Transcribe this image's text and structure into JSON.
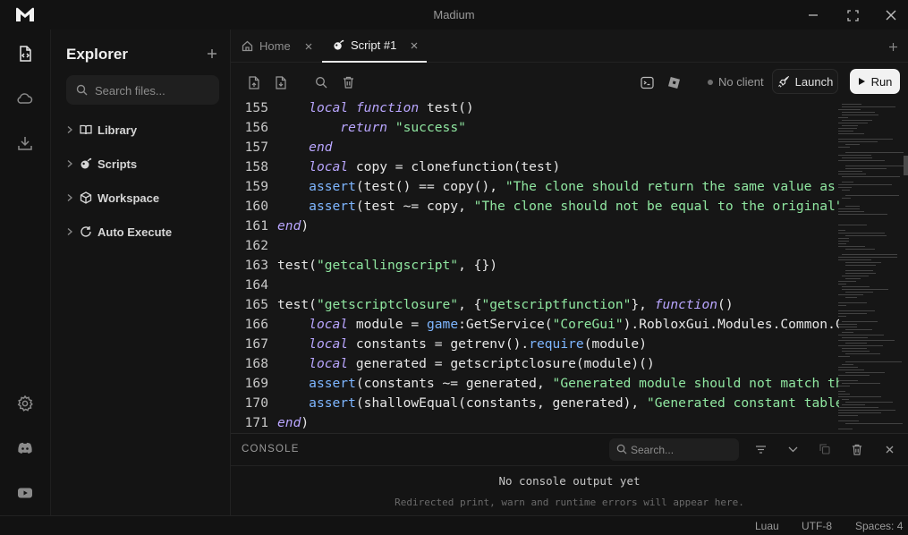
{
  "app": {
    "title": "Madium"
  },
  "explorer": {
    "title": "Explorer",
    "search_placeholder": "Search files...",
    "items": [
      {
        "label": "Library",
        "icon": "book-icon"
      },
      {
        "label": "Scripts",
        "icon": "script-icon"
      },
      {
        "label": "Workspace",
        "icon": "cube-icon"
      },
      {
        "label": "Auto Execute",
        "icon": "refresh-icon"
      }
    ]
  },
  "tabs": [
    {
      "label": "Home",
      "icon": "home-icon",
      "active": false
    },
    {
      "label": "Script #1",
      "icon": "script-icon",
      "active": true
    }
  ],
  "toolbar": {
    "client_status": "No client",
    "launch_label": "Launch",
    "run_label": "Run"
  },
  "editor": {
    "lines": [
      {
        "n": "155",
        "tokens": [
          [
            "",
            "    "
          ],
          [
            "kw",
            "local"
          ],
          [
            "",
            " "
          ],
          [
            "kw",
            "function"
          ],
          [
            "",
            " test()"
          ]
        ]
      },
      {
        "n": "156",
        "tokens": [
          [
            "",
            "        "
          ],
          [
            "kw",
            "return"
          ],
          [
            "",
            " "
          ],
          [
            "str",
            "\"success\""
          ]
        ]
      },
      {
        "n": "157",
        "tokens": [
          [
            "",
            "    "
          ],
          [
            "kw",
            "end"
          ]
        ]
      },
      {
        "n": "158",
        "tokens": [
          [
            "",
            "    "
          ],
          [
            "kw",
            "local"
          ],
          [
            "",
            " copy = clonefunction(test)"
          ]
        ]
      },
      {
        "n": "159",
        "tokens": [
          [
            "",
            "    "
          ],
          [
            "fnc",
            "assert"
          ],
          [
            "",
            "(test() == copy(), "
          ],
          [
            "str",
            "\"The clone should return the same value as the original\""
          ],
          [
            "",
            ")"
          ]
        ]
      },
      {
        "n": "160",
        "tokens": [
          [
            "",
            "    "
          ],
          [
            "fnc",
            "assert"
          ],
          [
            "",
            "(test ~= copy, "
          ],
          [
            "str",
            "\"The clone should not be equal to the original\""
          ],
          [
            "",
            ")"
          ]
        ]
      },
      {
        "n": "161",
        "tokens": [
          [
            "kw",
            "end"
          ],
          [
            "",
            ")"
          ]
        ]
      },
      {
        "n": "162",
        "tokens": []
      },
      {
        "n": "163",
        "tokens": [
          [
            "",
            "test("
          ],
          [
            "str",
            "\"getcallingscript\""
          ],
          [
            "",
            ", {})"
          ]
        ]
      },
      {
        "n": "164",
        "tokens": []
      },
      {
        "n": "165",
        "tokens": [
          [
            "",
            "test("
          ],
          [
            "str",
            "\"getscriptclosure\""
          ],
          [
            "",
            ", {"
          ],
          [
            "str",
            "\"getscriptfunction\""
          ],
          [
            "",
            "}, "
          ],
          [
            "kw",
            "function"
          ],
          [
            "",
            "()"
          ]
        ]
      },
      {
        "n": "166",
        "tokens": [
          [
            "",
            "    "
          ],
          [
            "kw",
            "local"
          ],
          [
            "",
            " module = "
          ],
          [
            "fnc",
            "game"
          ],
          [
            "",
            ":GetService("
          ],
          [
            "str",
            "\"CoreGui\""
          ],
          [
            "",
            ").RobloxGui.Modules.Common.Constants"
          ]
        ]
      },
      {
        "n": "167",
        "tokens": [
          [
            "",
            "    "
          ],
          [
            "kw",
            "local"
          ],
          [
            "",
            " constants = getrenv()."
          ],
          [
            "fnc",
            "require"
          ],
          [
            "",
            "(module)"
          ]
        ]
      },
      {
        "n": "168",
        "tokens": [
          [
            "",
            "    "
          ],
          [
            "kw",
            "local"
          ],
          [
            "",
            " generated = getscriptclosure(module)()"
          ]
        ]
      },
      {
        "n": "169",
        "tokens": [
          [
            "",
            "    "
          ],
          [
            "fnc",
            "assert"
          ],
          [
            "",
            "(constants ~= generated, "
          ],
          [
            "str",
            "\"Generated module should not match the original\""
          ],
          [
            "",
            ")"
          ]
        ]
      },
      {
        "n": "170",
        "tokens": [
          [
            "",
            "    "
          ],
          [
            "fnc",
            "assert"
          ],
          [
            "",
            "(shallowEqual(constants, generated), "
          ],
          [
            "str",
            "\"Generated constant table should be shallow equal to the original\""
          ],
          [
            "",
            ")"
          ]
        ]
      },
      {
        "n": "171",
        "tokens": [
          [
            "kw",
            "end"
          ],
          [
            "",
            ")"
          ]
        ]
      }
    ]
  },
  "console": {
    "title": "CONSOLE",
    "search_placeholder": "Search...",
    "empty_title": "No console output yet",
    "empty_hint": "Redirected print, warn and runtime errors will appear here."
  },
  "statusbar": {
    "language": "Luau",
    "encoding": "UTF-8",
    "indent": "Spaces: 4"
  }
}
